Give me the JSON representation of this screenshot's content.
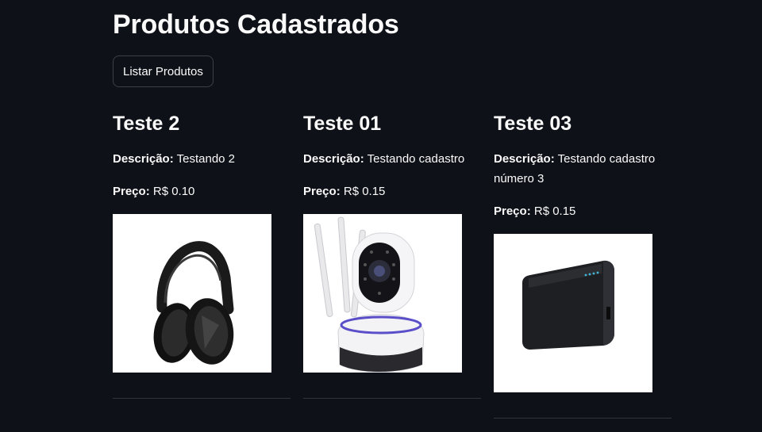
{
  "page": {
    "title": "Produtos Cadastrados",
    "list_button_label": "Listar Produtos"
  },
  "labels": {
    "description": "Descrição:",
    "price": "Preço:"
  },
  "products": [
    {
      "name": "Teste 2",
      "description": "Testando 2",
      "price": "R$ 0.10",
      "image": "headphones"
    },
    {
      "name": "Teste 01",
      "description": "Testando cadastro",
      "price": "R$ 0.15",
      "image": "security camera"
    },
    {
      "name": "Teste 03",
      "description": "Testando cadastro número 3",
      "price": "R$ 0.15",
      "image": "power bank"
    }
  ],
  "colors": {
    "background": "#0e1117",
    "text": "#fafafa",
    "divider": "#31333d"
  }
}
